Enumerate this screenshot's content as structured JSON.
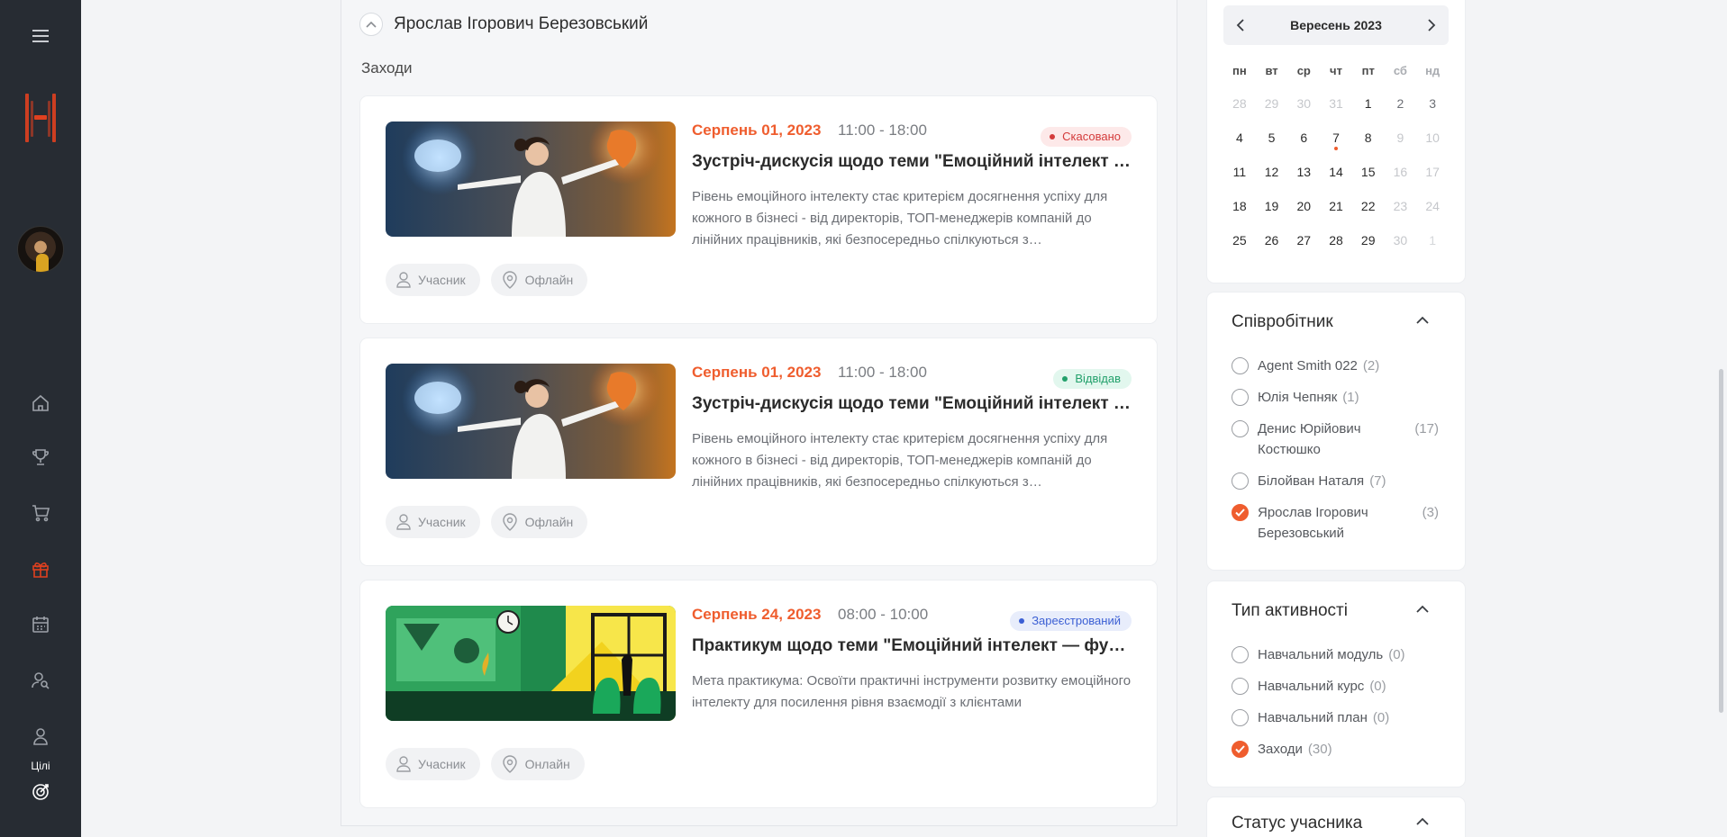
{
  "sidebar": {
    "nav": [
      "menu-icon",
      "home-icon",
      "trophy-icon",
      "cart-icon",
      "gift-icon",
      "calendar-icon",
      "user-search-icon",
      "user-icon",
      "target-icon"
    ],
    "goals_label": "Цілі",
    "active_color": "#e0401f"
  },
  "main": {
    "person_name": "Ярослав Ігорович Березовський",
    "section_title": "Заходи",
    "cards": [
      {
        "date": "Серпень 01, 2023",
        "time": "11:00 - 18:00",
        "status": "Скасовано",
        "title": "Зустріч-дискусія щодо теми \"Емоційний інтелект — сила, яка змінює бізнес\"",
        "description": "Рівень емоційного інтелекту стає критерієм досягнення успіху для кожного в бізнесі - від директорів, ТОП-менеджерів компаній до лінійних працівників, які безпосередньо спілкуються з…",
        "role": "Учасник",
        "format": "Офлайн"
      },
      {
        "date": "Серпень 01, 2023",
        "time": "11:00 - 18:00",
        "status": "Відвідав",
        "title": "Зустріч-дискусія щодо теми \"Емоційний інтелект — сила, яка змінює бізнес\"",
        "description": "Рівень емоційного інтелекту стає критерієм досягнення успіху для кожного в бізнесі - від директорів, ТОП-менеджерів компаній до лінійних працівників, які безпосередньо спілкуються з…",
        "role": "Учасник",
        "format": "Офлайн"
      },
      {
        "date": "Серпень 24, 2023",
        "time": "08:00 - 10:00",
        "status": "Зареєстрований",
        "title": "Практикум щодо теми \"Емоційний інтелект — фундамент взаємодії з клієнтами\"",
        "description": "Мета практикума: Освоїти практичні інструменти розвитку емоційного інтелекту для посилення рівня взаємодії з клієнтами",
        "role": "Учасник",
        "format": "Онлайн"
      }
    ]
  },
  "calendar": {
    "month": "Вересень 2023",
    "weekdays": [
      "пн",
      "вт",
      "ср",
      "чт",
      "пт",
      "сб",
      "нд"
    ],
    "rows": [
      [
        "28",
        "29",
        "30",
        "31",
        "1",
        "2",
        "3"
      ],
      [
        "4",
        "5",
        "6",
        "7",
        "8",
        "9",
        "10"
      ],
      [
        "11",
        "12",
        "13",
        "14",
        "15",
        "16",
        "17"
      ],
      [
        "18",
        "19",
        "20",
        "21",
        "22",
        "23",
        "24"
      ],
      [
        "25",
        "26",
        "27",
        "28",
        "29",
        "30",
        "1"
      ]
    ]
  },
  "employee_filter": {
    "title": "Співробітник",
    "items": [
      {
        "label": "Agent Smith 022",
        "count": "(2)",
        "checked": false
      },
      {
        "label": "Юлія Чепняк",
        "count": "(1)",
        "checked": false
      },
      {
        "label": "Денис Юрійович Костюшко",
        "count": "(17)",
        "checked": false
      },
      {
        "label": "Білойван Наталя",
        "count": "(7)",
        "checked": false
      },
      {
        "label": "Ярослав Ігорович Березовський",
        "count": "(3)",
        "checked": true
      }
    ]
  },
  "activity_filter": {
    "title": "Тип активності",
    "items": [
      {
        "label": "Навчальний модуль",
        "count": "(0)",
        "checked": false
      },
      {
        "label": "Навчальний курс",
        "count": "(0)",
        "checked": false
      },
      {
        "label": "Навчальний план",
        "count": "(0)",
        "checked": false
      },
      {
        "label": "Заходи",
        "count": "(30)",
        "checked": true
      }
    ]
  },
  "participant_status": {
    "title": "Статус учасника"
  },
  "colors": {
    "accent": "#ef5d2e",
    "sidebar_bg": "#272c33",
    "cancel": "#d43b3b",
    "visited": "#22a06b",
    "registered": "#3b5fd4"
  }
}
